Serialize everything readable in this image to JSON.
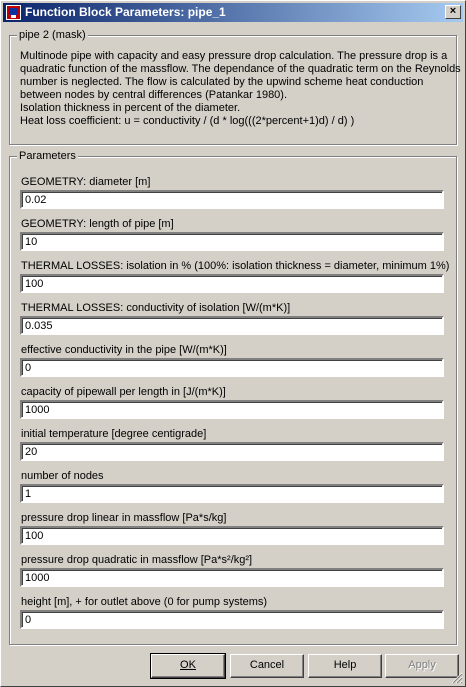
{
  "window": {
    "title": "Function Block Parameters: pipe_1",
    "close_label": "×"
  },
  "mask": {
    "legend": "pipe 2 (mask)",
    "lines": [
      "Multinode pipe with capacity and easy pressure drop calculation. The pressure drop is a",
      "quadratic function of the massflow. The dependance of the quadratic term on the Reynolds",
      "number is neglected. The flow is calculated by the upwind scheme heat conduction",
      "between nodes by central differences (Patankar 1980).",
      "Isolation thickness in percent of the diameter.",
      "Heat loss coefficient: u = conductivity / (d * log(((2*percent+1)d) / d) )"
    ]
  },
  "parameters": {
    "legend": "Parameters",
    "items": [
      {
        "label": "GEOMETRY: diameter [m]",
        "value": "0.02"
      },
      {
        "label": "GEOMETRY: length of pipe [m]",
        "value": "10"
      },
      {
        "label": "THERMAL LOSSES: isolation in % (100%: isolation thickness = diameter, minimum 1%)",
        "value": "100"
      },
      {
        "label": "THERMAL LOSSES: conductivity of isolation [W/(m*K)]",
        "value": "0.035"
      },
      {
        "label": "effective conductivity in the pipe [W/(m*K)]",
        "value": "0"
      },
      {
        "label": "capacity of pipewall per length in [J/(m*K)]",
        "value": "1000"
      },
      {
        "label": "initial temperature [degree centigrade]",
        "value": "20"
      },
      {
        "label": "number of nodes",
        "value": "1"
      },
      {
        "label": "pressure drop linear in massflow [Pa*s/kg]",
        "value": "100"
      },
      {
        "label": "pressure drop quadratic in massflow [Pa*s²/kg²]",
        "value": "1000"
      },
      {
        "label": "height [m], + for outlet above (0 for pump systems)",
        "value": "0"
      }
    ]
  },
  "buttons": {
    "ok": "OK",
    "cancel": "Cancel",
    "help": "Help",
    "apply": "Apply"
  }
}
